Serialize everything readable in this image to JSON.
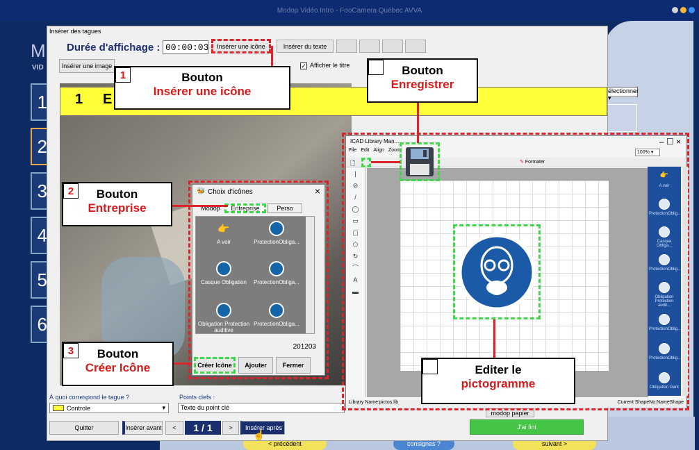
{
  "app": {
    "title": "Modop Vidéo Intro - FooCamera Québec AVVA"
  },
  "background": {
    "logo_letter": "M",
    "logo_text": "VID",
    "sidebar_numbers": [
      "1",
      "2",
      "3",
      "4",
      "5",
      "6"
    ],
    "right_dropdown": "électionner",
    "bottom_buttons": {
      "prev": "< précédent",
      "consignes": "consignes ?",
      "next": "suivant >"
    }
  },
  "tag_window": {
    "title": "Insérer des tagues",
    "duration_label": "Durée d'affichage :",
    "duration_value": "00:00:03",
    "insert_icon_btn": "Insérer une icône",
    "insert_text_btn": "Insérer du texte",
    "insert_image_btn": "Insérer une image",
    "show_title_label": "Afficher le titre",
    "yellow_number": "1",
    "yellow_text": "E",
    "which_label": "À quoi correspond le tague ?",
    "which_value": "Controle",
    "keypoints_label": "Points clefs :",
    "keypoints_value": "Texte du point clé",
    "modop_label": "modop papier",
    "quit_btn": "Quitter",
    "insert_before_btn": "Insérer avant",
    "prev_btn": "<",
    "page": "1 / 1",
    "next_btn": ">",
    "insert_after_btn": "Insérer après",
    "done_btn": "J'ai fini",
    "accent_green": "#45c445",
    "accent_yellow": "#ffff3a"
  },
  "icon_dialog": {
    "title": "Choix d'icônes",
    "tabs": [
      "Modop",
      "Entreprise",
      "Perso"
    ],
    "icons": [
      {
        "label": "A voir",
        "icon": "hand-pointer-icon"
      },
      {
        "label": "ProtectionObliga...",
        "icon": "protection-mask-icon"
      },
      {
        "label": "Casque Obligation",
        "icon": "helmet-icon"
      },
      {
        "label": "ProtectionObliga...",
        "icon": "protection-icon"
      },
      {
        "label": "Obligation Protection auditive",
        "icon": "ear-protection-icon"
      },
      {
        "label": "ProtectionObliga...",
        "icon": "protection-icon"
      }
    ],
    "code": "201203",
    "create_btn": "Créer Icône",
    "add_btn": "Ajouter",
    "close_btn": "Fermer"
  },
  "cad_window": {
    "title": "ICAD Library Man...",
    "menu": [
      "File",
      "Edit",
      "Align",
      "Zoom"
    ],
    "zoom": "100%",
    "font_label": "Formater",
    "status_left": "Library Name:pictos.lib",
    "status_mid": "(69,110)",
    "status_right": "Current ShapeNo:NameShape",
    "palette": [
      "A voir",
      "ProtectionOblig...",
      "Casque Obliga...",
      "ProtectionOblig...",
      "Obligation Protection audit...",
      "ProtectionOblig...",
      "ProtectionOblig...",
      "Obligation Gant"
    ]
  },
  "callouts": {
    "c1": {
      "num": "1",
      "line1": "Bouton",
      "line2": "Insérer une icône"
    },
    "c_save": {
      "line1": "Bouton",
      "line2": "Enregistrer"
    },
    "c2": {
      "num": "2",
      "line1": "Bouton",
      "line2": "Entreprise"
    },
    "c3": {
      "num": "3",
      "line1": "Bouton",
      "line2": "Créer Icône"
    },
    "c_edit": {
      "line1": "Editer le",
      "line2": "pictogramme"
    }
  }
}
